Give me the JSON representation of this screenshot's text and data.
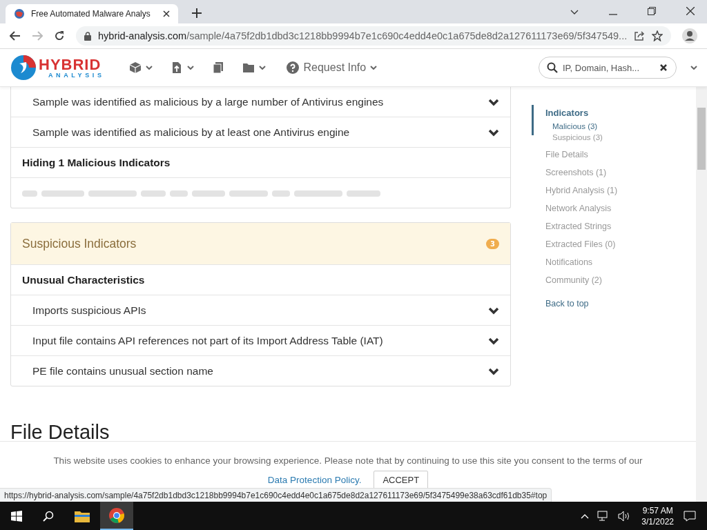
{
  "browser": {
    "tab_title": "Free Automated Malware Analys",
    "url_host": "hybrid-analysis.com",
    "url_path": "/sample/4a75f2db1dbd3c1218bb9994b7e1c690c4edd4e0c1a675de8d2a127611173e69/5f347549..."
  },
  "site_header": {
    "logo_top": "HYBRID",
    "logo_bottom": "ANALYSIS",
    "nav_label": "Request Info",
    "search": {
      "placeholder": "IP, Domain, Hash..."
    }
  },
  "malicious_card": {
    "rows": [
      {
        "kind": "indicator",
        "text": "Sample was identified as malicious by a large number of Antivirus engines"
      },
      {
        "kind": "indicator",
        "text": "Sample was identified as malicious by at least one Antivirus engine"
      },
      {
        "kind": "group",
        "text": "Hiding 1 Malicious Indicators"
      },
      {
        "kind": "hidden"
      }
    ]
  },
  "suspicious_card": {
    "title": "Suspicious Indicators",
    "badge": "3",
    "rows": [
      {
        "kind": "group",
        "text": "Unusual Characteristics"
      },
      {
        "kind": "indicator",
        "text": "Imports suspicious APIs"
      },
      {
        "kind": "indicator",
        "text": "Input file contains API references not part of its Import Address Table (IAT)"
      },
      {
        "kind": "indicator",
        "text": "PE file contains unusual section name"
      }
    ]
  },
  "section_heading": "File Details",
  "sidebar": {
    "items": [
      {
        "label": "Indicators",
        "selected": true,
        "children": [
          {
            "label": "Malicious (3)",
            "selected": true
          },
          {
            "label": "Suspicious (3)",
            "selected": false
          }
        ]
      },
      {
        "label": "File Details",
        "selected": false
      },
      {
        "label": "Screenshots (1)",
        "selected": false
      },
      {
        "label": "Hybrid Analysis (1)",
        "selected": false
      },
      {
        "label": "Network Analysis",
        "selected": false
      },
      {
        "label": "Extracted Strings",
        "selected": false
      },
      {
        "label": "Extracted Files (0)",
        "selected": false
      },
      {
        "label": "Notifications",
        "selected": false
      },
      {
        "label": "Community (2)",
        "selected": false
      }
    ],
    "back_link": "Back to top"
  },
  "cookie_banner": {
    "text": "This website uses cookies to enhance your browsing experience. Please note that by continuing to use this site you consent to the terms of our",
    "link": "Data Protection Policy.",
    "button": "ACCEPT"
  },
  "status_url": "https://hybrid-analysis.com/sample/4a75f2db1dbd3c1218bb9994b7e1c690c4edd4e0c1a675de8d2a127611173e69/5f3475499e38a63cdf61db35#top",
  "taskbar": {
    "time": "9:57 AM",
    "date": "3/1/2022"
  }
}
